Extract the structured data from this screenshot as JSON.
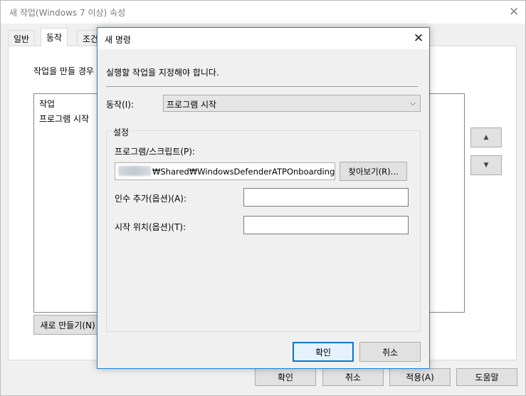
{
  "parent_window": {
    "title": "새 작업(Windows 7 이상) 속성",
    "close_glyph": "✕",
    "tabs": [
      {
        "label": "일반",
        "active": false
      },
      {
        "label": "동작",
        "active": true
      },
      {
        "label": "조건",
        "active": false
      }
    ],
    "description": "작업을 만들 경우",
    "list": {
      "column_header": "작업",
      "rows": [
        "프로그램 시작"
      ]
    },
    "move_up_glyph": "▲",
    "move_down_glyph": "▼",
    "new_button": "새로 만들기(N)",
    "buttons": {
      "ok": "확인",
      "cancel": "취소",
      "apply": "적용(A)",
      "help": "도움말"
    }
  },
  "dialog": {
    "title": "새 명령",
    "close_glyph": "✕",
    "description": "실행할 작업을 지정해야 합니다.",
    "action": {
      "label": "동작(I):",
      "selected": "프로그램 시작",
      "arrow_glyph": "⌵"
    },
    "settings": {
      "legend": "설정",
      "program_label": "프로그램/스크립트(P):",
      "program_value": "₩Shared₩WindowsDefenderATPOnboardingScr",
      "browse_button": "찾아보기(R)...",
      "args_label": "인수 추가(옵션)(A):",
      "args_value": "",
      "start_label": "시작 위치(옵션)(T):",
      "start_value": ""
    },
    "buttons": {
      "ok": "확인",
      "cancel": "취소"
    }
  },
  "colors": {
    "accent": "#0078d7",
    "dialog_border": "#1883d7",
    "window_bg": "#f0f0f0"
  }
}
